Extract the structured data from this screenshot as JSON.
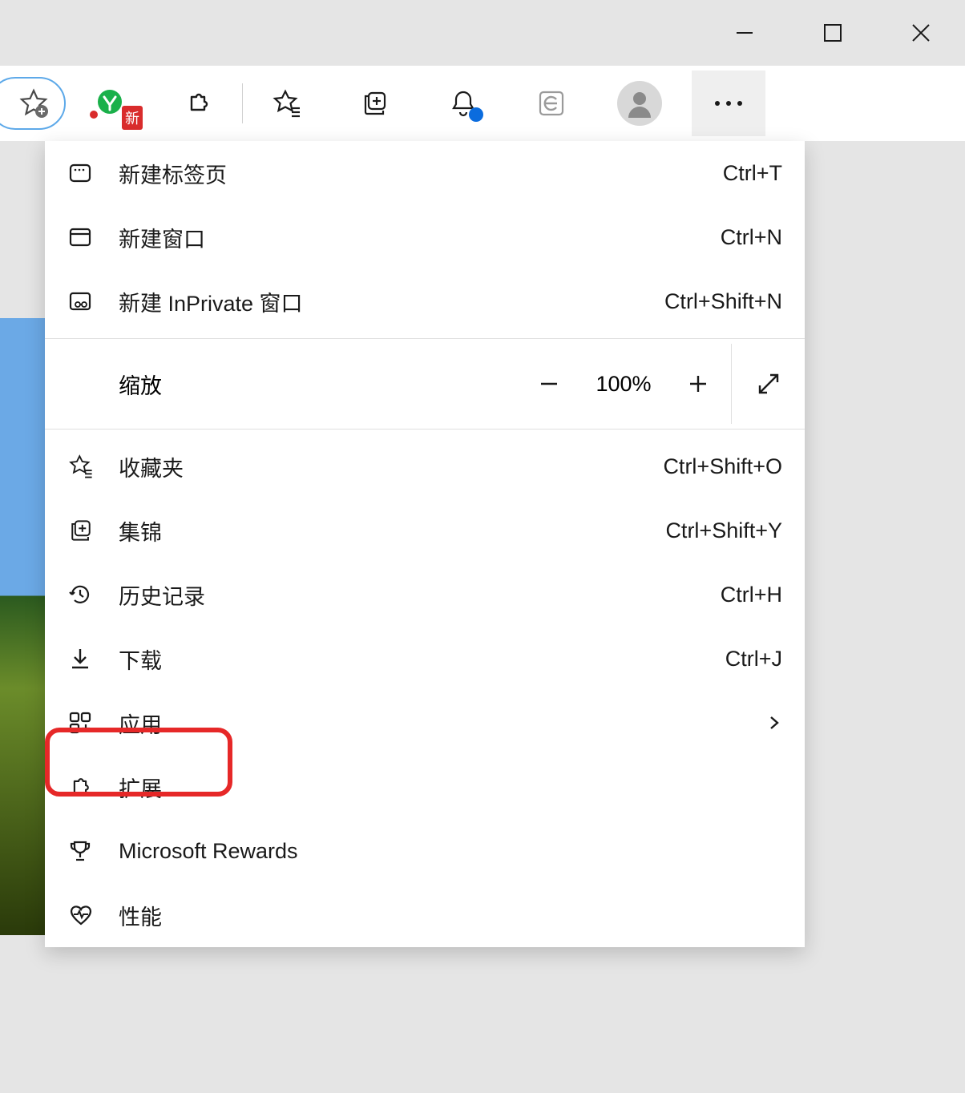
{
  "window_controls": {
    "minimize": "—",
    "maximize": "□",
    "close": "✕"
  },
  "toolbar": {
    "ext_badge": "新"
  },
  "menu": {
    "new_tab": {
      "label": "新建标签页",
      "shortcut": "Ctrl+T"
    },
    "new_window": {
      "label": "新建窗口",
      "shortcut": "Ctrl+N"
    },
    "new_inprivate": {
      "label": "新建 InPrivate 窗口",
      "shortcut": "Ctrl+Shift+N"
    },
    "zoom": {
      "label": "缩放",
      "value": "100%"
    },
    "favorites": {
      "label": "收藏夹",
      "shortcut": "Ctrl+Shift+O"
    },
    "collections": {
      "label": "集锦",
      "shortcut": "Ctrl+Shift+Y"
    },
    "history": {
      "label": "历史记录",
      "shortcut": "Ctrl+H"
    },
    "downloads": {
      "label": "下载",
      "shortcut": "Ctrl+J"
    },
    "apps": {
      "label": "应用"
    },
    "extensions": {
      "label": "扩展"
    },
    "rewards": {
      "label": "Microsoft Rewards"
    },
    "performance": {
      "label": "性能"
    }
  }
}
